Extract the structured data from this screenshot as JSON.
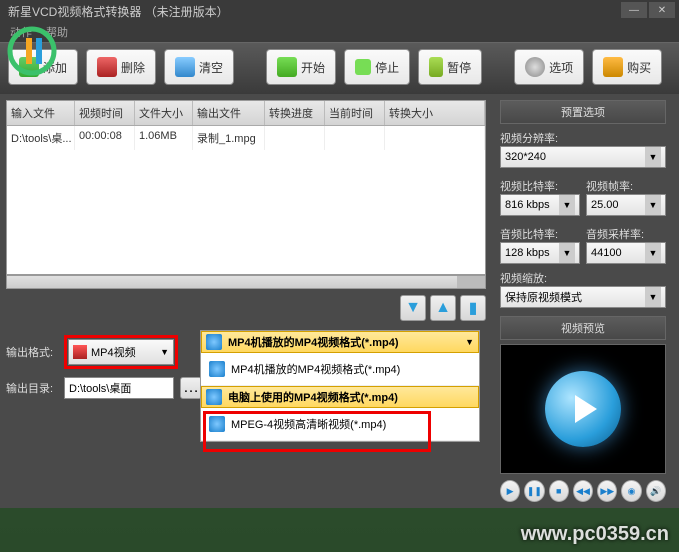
{
  "title": "新星VCD视频格式转换器 （未注册版本）",
  "menu": {
    "m1": "动作",
    "m2": "帮助"
  },
  "toolbar": {
    "add": "添加",
    "del": "删除",
    "clear": "清空",
    "start": "开始",
    "stop": "停止",
    "pause": "暂停",
    "options": "选项",
    "buy": "购买"
  },
  "columns": {
    "c1": "输入文件",
    "c2": "视频时间",
    "c3": "文件大小",
    "c4": "输出文件",
    "c5": "转换进度",
    "c6": "当前时间",
    "c7": "转换大小"
  },
  "rows": [
    {
      "input": "D:\\tools\\桌...",
      "duration": "00:00:08",
      "size": "1.06MB",
      "output": "录制_1.mpg",
      "progress": "",
      "time": "",
      "outsize": ""
    }
  ],
  "outputFormat": {
    "label": "输出格式:",
    "value": "MP4视频"
  },
  "outputDir": {
    "label": "输出目录:",
    "value": "D:\\tools\\桌面"
  },
  "dropdown": {
    "header": "MP4机播放的MP4视频格式(*.mp4)",
    "items": [
      "MP4机播放的MP4视频格式(*.mp4)",
      "电脑上使用的MP4视频格式(*.mp4)",
      "MPEG-4视频高清晰视频(*.mp4)"
    ]
  },
  "presetPanel": {
    "title": "预置选项",
    "resLabel": "视频分辨率:",
    "res": "320*240",
    "vbLabel": "视频比特率:",
    "vb": "816 kbps",
    "fpsLabel": "视频帧率:",
    "fps": "25.00",
    "abLabel": "音频比特率:",
    "ab": "128 kbps",
    "srLabel": "音频采样率:",
    "sr": "44100",
    "zoomLabel": "视频缩放:",
    "zoom": "保持原视频模式"
  },
  "previewTitle": "视频预览",
  "watermark": "www.pc0359.cn"
}
